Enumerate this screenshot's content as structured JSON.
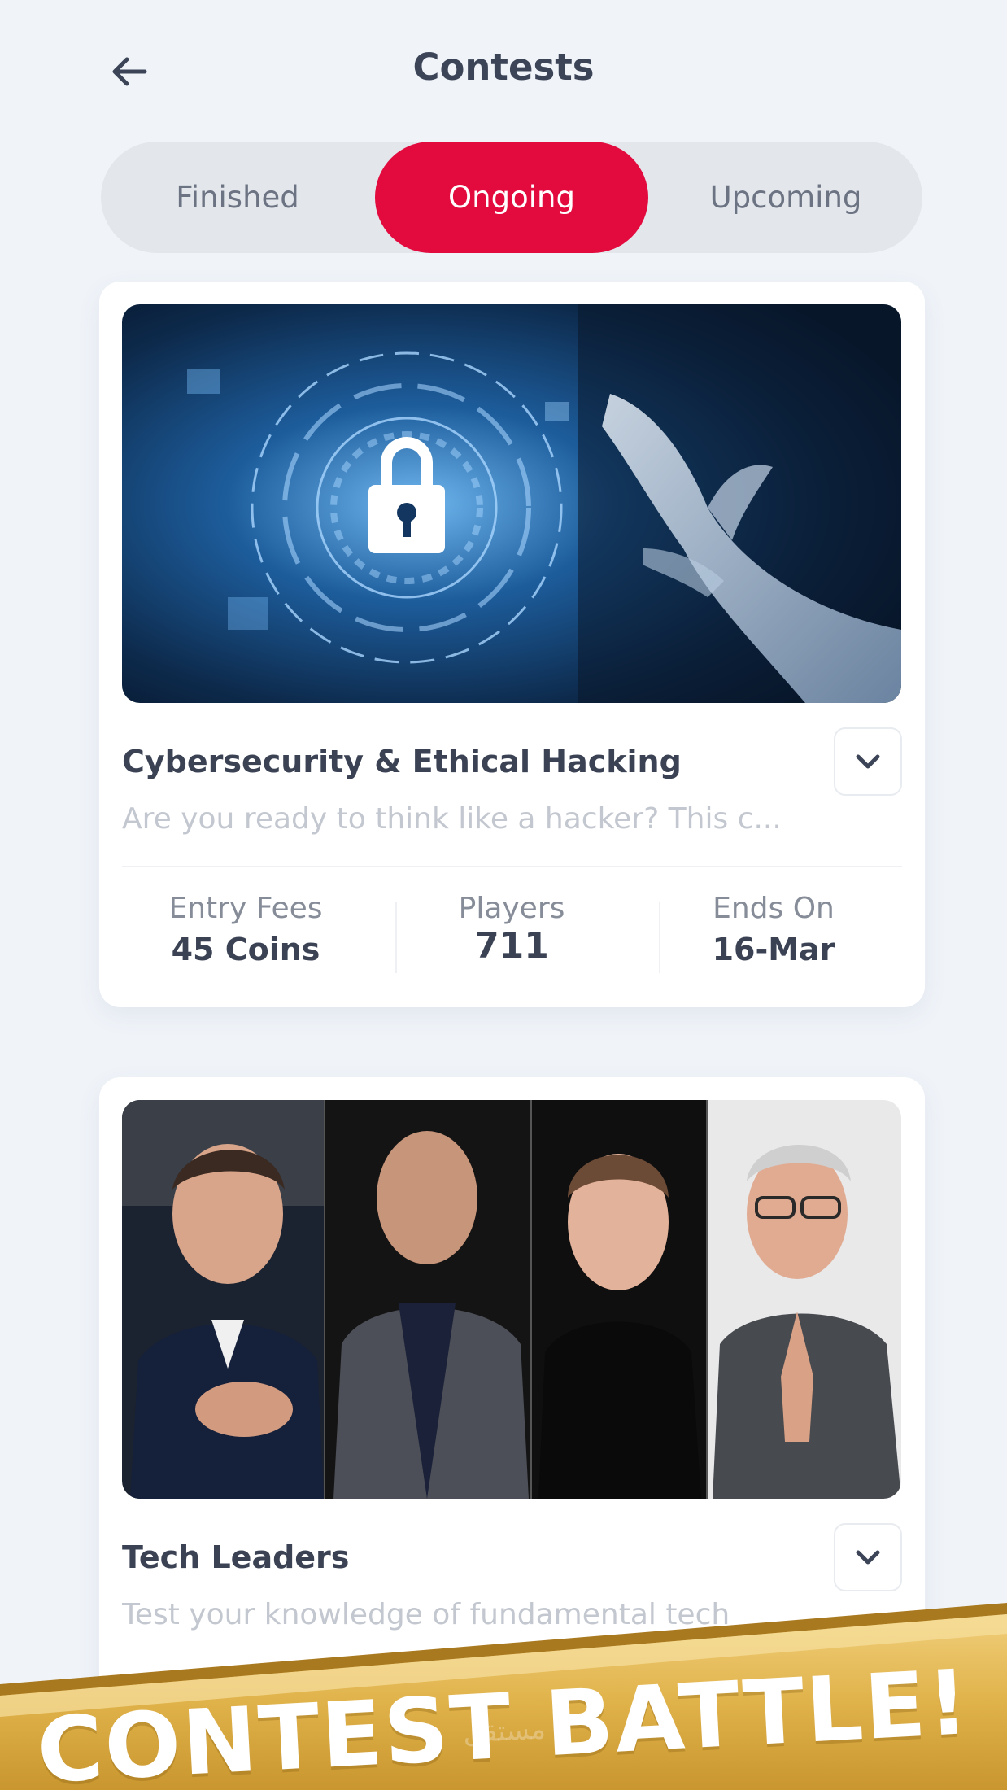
{
  "header": {
    "title": "Contests"
  },
  "tabs": [
    {
      "label": "Finished"
    },
    {
      "label": "Ongoing",
      "active": true
    },
    {
      "label": "Upcoming"
    }
  ],
  "contests": [
    {
      "title": "Cybersecurity & Ethical Hacking",
      "description": "Are you ready to think like a hacker? This c...",
      "stats": {
        "entry_fees_label": "Entry Fees",
        "entry_fees_value": "45 Coins",
        "players_label": "Players",
        "players_value": "711",
        "ends_on_label": "Ends On",
        "ends_on_value": "16-Mar"
      }
    },
    {
      "title": "Tech Leaders",
      "description": "Test your knowledge of fundamental tech"
    }
  ],
  "banner": {
    "text": "CONTEST BATTLE!",
    "watermark": "مستقل"
  },
  "colors": {
    "accent": "#e30a3e",
    "background": "#f0f4f9",
    "banner_gold": "#e0b24a"
  }
}
